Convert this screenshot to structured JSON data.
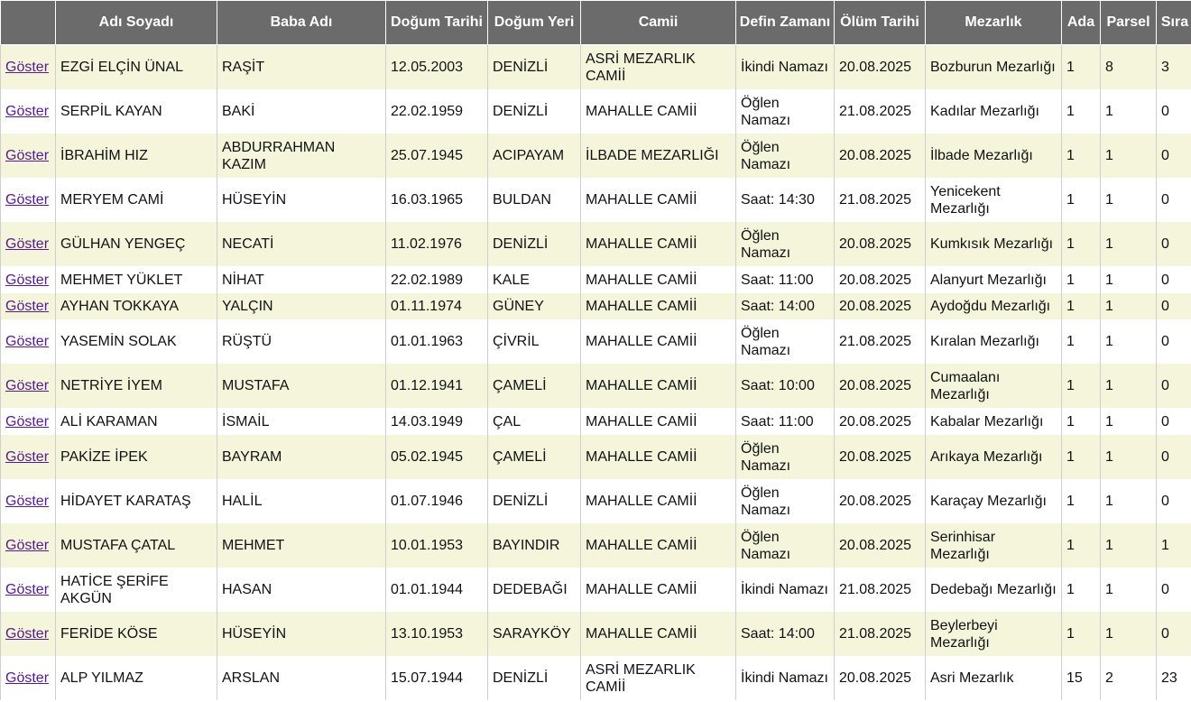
{
  "headers": [
    "",
    "Adı Soyadı",
    "Baba Adı",
    "Doğum Tarihi",
    "Doğum Yeri",
    "Camii",
    "Defin Zamanı",
    "Ölüm Tarihi",
    "Mezarlık",
    "Ada",
    "Parsel",
    "Sıra"
  ],
  "link_label": "Göster",
  "rows": [
    {
      "name": "EZGİ ELÇİN ÜNAL",
      "father": "RAŞİT",
      "birth_date": "12.05.2003",
      "birth_place": "DENİZLİ",
      "mosque": "ASRİ MEZARLIK CAMİİ",
      "burial_time": "İkindi Namazı",
      "death_date": "20.08.2025",
      "cemetery": "Bozburun Mezarlığı",
      "ada": "1",
      "parsel": "8",
      "sira": "3"
    },
    {
      "name": "SERPİL KAYAN",
      "father": "BAKİ",
      "birth_date": "22.02.1959",
      "birth_place": "DENİZLİ",
      "mosque": "MAHALLE CAMİİ",
      "burial_time": "Öğlen Namazı",
      "death_date": "21.08.2025",
      "cemetery": "Kadılar Mezarlığı",
      "ada": "1",
      "parsel": "1",
      "sira": "0"
    },
    {
      "name": "İBRAHİM HIZ",
      "father": "ABDURRAHMAN KAZIM",
      "birth_date": "25.07.1945",
      "birth_place": "ACIPAYAM",
      "mosque": "İLBADE MEZARLIĞI",
      "burial_time": "Öğlen Namazı",
      "death_date": "20.08.2025",
      "cemetery": "İlbade Mezarlığı",
      "ada": "1",
      "parsel": "1",
      "sira": "0"
    },
    {
      "name": "MERYEM CAMİ",
      "father": "HÜSEYİN",
      "birth_date": "16.03.1965",
      "birth_place": "BULDAN",
      "mosque": "MAHALLE CAMİİ",
      "burial_time": "Saat: 14:30",
      "death_date": "21.08.2025",
      "cemetery": "Yenicekent Mezarlığı",
      "ada": "1",
      "parsel": "1",
      "sira": "0"
    },
    {
      "name": "GÜLHAN YENGEÇ",
      "father": "NECATİ",
      "birth_date": "11.02.1976",
      "birth_place": "DENİZLİ",
      "mosque": "MAHALLE CAMİİ",
      "burial_time": "Öğlen Namazı",
      "death_date": "20.08.2025",
      "cemetery": "Kumkısık Mezarlığı",
      "ada": "1",
      "parsel": "1",
      "sira": "0"
    },
    {
      "name": "MEHMET YÜKLET",
      "father": "NİHAT",
      "birth_date": "22.02.1989",
      "birth_place": "KALE",
      "mosque": "MAHALLE CAMİİ",
      "burial_time": "Saat: 11:00",
      "death_date": "20.08.2025",
      "cemetery": "Alanyurt Mezarlığı",
      "ada": "1",
      "parsel": "1",
      "sira": "0"
    },
    {
      "name": "AYHAN TOKKAYA",
      "father": "YALÇIN",
      "birth_date": "01.11.1974",
      "birth_place": "GÜNEY",
      "mosque": "MAHALLE CAMİİ",
      "burial_time": "Saat: 14:00",
      "death_date": "20.08.2025",
      "cemetery": "Aydoğdu Mezarlığı",
      "ada": "1",
      "parsel": "1",
      "sira": "0"
    },
    {
      "name": "YASEMİN SOLAK",
      "father": "RÜŞTÜ",
      "birth_date": "01.01.1963",
      "birth_place": "ÇİVRİL",
      "mosque": "MAHALLE CAMİİ",
      "burial_time": "Öğlen Namazı",
      "death_date": "21.08.2025",
      "cemetery": "Kıralan Mezarlığı",
      "ada": "1",
      "parsel": "1",
      "sira": "0"
    },
    {
      "name": "NETRİYE İYEM",
      "father": "MUSTAFA",
      "birth_date": "01.12.1941",
      "birth_place": "ÇAMELİ",
      "mosque": "MAHALLE CAMİİ",
      "burial_time": "Saat: 10:00",
      "death_date": "20.08.2025",
      "cemetery": "Cumaalanı Mezarlığı",
      "ada": "1",
      "parsel": "1",
      "sira": "0"
    },
    {
      "name": "ALİ KARAMAN",
      "father": "İSMAİL",
      "birth_date": "14.03.1949",
      "birth_place": "ÇAL",
      "mosque": "MAHALLE CAMİİ",
      "burial_time": "Saat: 11:00",
      "death_date": "20.08.2025",
      "cemetery": "Kabalar Mezarlığı",
      "ada": "1",
      "parsel": "1",
      "sira": "0"
    },
    {
      "name": "PAKİZE İPEK",
      "father": "BAYRAM",
      "birth_date": "05.02.1945",
      "birth_place": "ÇAMELİ",
      "mosque": "MAHALLE CAMİİ",
      "burial_time": "Öğlen Namazı",
      "death_date": "20.08.2025",
      "cemetery": "Arıkaya Mezarlığı",
      "ada": "1",
      "parsel": "1",
      "sira": "0"
    },
    {
      "name": "HİDAYET KARATAŞ",
      "father": "HALİL",
      "birth_date": "01.07.1946",
      "birth_place": "DENİZLİ",
      "mosque": "MAHALLE CAMİİ",
      "burial_time": "Öğlen Namazı",
      "death_date": "20.08.2025",
      "cemetery": "Karaçay Mezarlığı",
      "ada": "1",
      "parsel": "1",
      "sira": "0"
    },
    {
      "name": "MUSTAFA ÇATAL",
      "father": "MEHMET",
      "birth_date": "10.01.1953",
      "birth_place": "BAYINDIR",
      "mosque": "MAHALLE CAMİİ",
      "burial_time": "Öğlen Namazı",
      "death_date": "20.08.2025",
      "cemetery": "Serinhisar Mezarlığı",
      "ada": "1",
      "parsel": "1",
      "sira": "1"
    },
    {
      "name": "HATİCE ŞERİFE AKGÜN",
      "father": "HASAN",
      "birth_date": "01.01.1944",
      "birth_place": "DEDEBAĞI",
      "mosque": "MAHALLE CAMİİ",
      "burial_time": "İkindi Namazı",
      "death_date": "21.08.2025",
      "cemetery": "Dedebağı Mezarlığı",
      "ada": "1",
      "parsel": "1",
      "sira": "0"
    },
    {
      "name": "FERİDE KÖSE",
      "father": "HÜSEYİN",
      "birth_date": "13.10.1953",
      "birth_place": "SARAYKÖY",
      "mosque": "MAHALLE CAMİİ",
      "burial_time": "Saat: 14:00",
      "death_date": "21.08.2025",
      "cemetery": "Beylerbeyi Mezarlığı",
      "ada": "1",
      "parsel": "1",
      "sira": "0"
    },
    {
      "name": "ALP YILMAZ",
      "father": "ARSLAN",
      "birth_date": "15.07.1944",
      "birth_place": "DENİZLİ",
      "mosque": "ASRİ MEZARLIK CAMİİ",
      "burial_time": "İkindi Namazı",
      "death_date": "20.08.2025",
      "cemetery": "Asri Mezarlık",
      "ada": "15",
      "parsel": "2",
      "sira": "23"
    }
  ]
}
